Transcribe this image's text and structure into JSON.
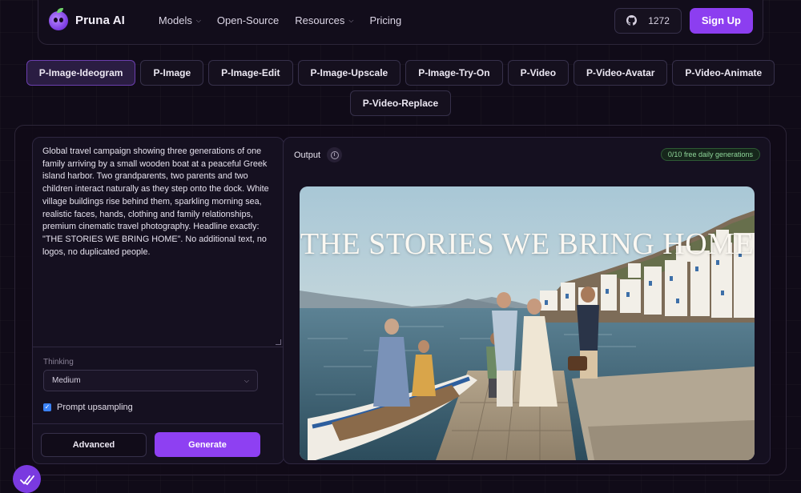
{
  "navbar": {
    "brand": "Pruna AI",
    "links": [
      {
        "label": "Models",
        "dropdown": true
      },
      {
        "label": "Open-Source",
        "dropdown": false
      },
      {
        "label": "Resources",
        "dropdown": true
      },
      {
        "label": "Pricing",
        "dropdown": false
      }
    ],
    "github_stars": "1272",
    "signup_label": "Sign Up"
  },
  "model_tabs": {
    "row1": [
      "P-Image-Ideogram",
      "P-Image",
      "P-Image-Edit",
      "P-Image-Upscale",
      "P-Image-Try-On",
      "P-Video",
      "P-Video-Avatar",
      "P-Video-Animate"
    ],
    "row2": [
      "P-Video-Replace"
    ],
    "active": "P-Image-Ideogram"
  },
  "form": {
    "prompt": "Global travel campaign showing three generations of one family arriving by a small wooden boat at a peaceful Greek island harbor. Two grandparents, two parents and two children interact naturally as they step onto the dock. White village buildings rise behind them, sparkling morning sea, realistic faces, hands, clothing and family relationships, premium cinematic travel photography. Headline exactly: \"THE STORIES WE BRING HOME\". No additional text, no logos, no duplicated people.",
    "thinking_label": "Thinking",
    "thinking_value": "Medium",
    "upsampling_label": "Prompt upsampling",
    "upsampling_checked": true,
    "advanced_label": "Advanced",
    "generate_label": "Generate"
  },
  "output": {
    "label": "Output",
    "badge": "0/10 free daily generations",
    "image_headline": "THE STORIES WE BRING HOME"
  },
  "colors": {
    "accent": "#8e40f2",
    "background": "#100b18",
    "badge_text": "#8fd79a"
  }
}
